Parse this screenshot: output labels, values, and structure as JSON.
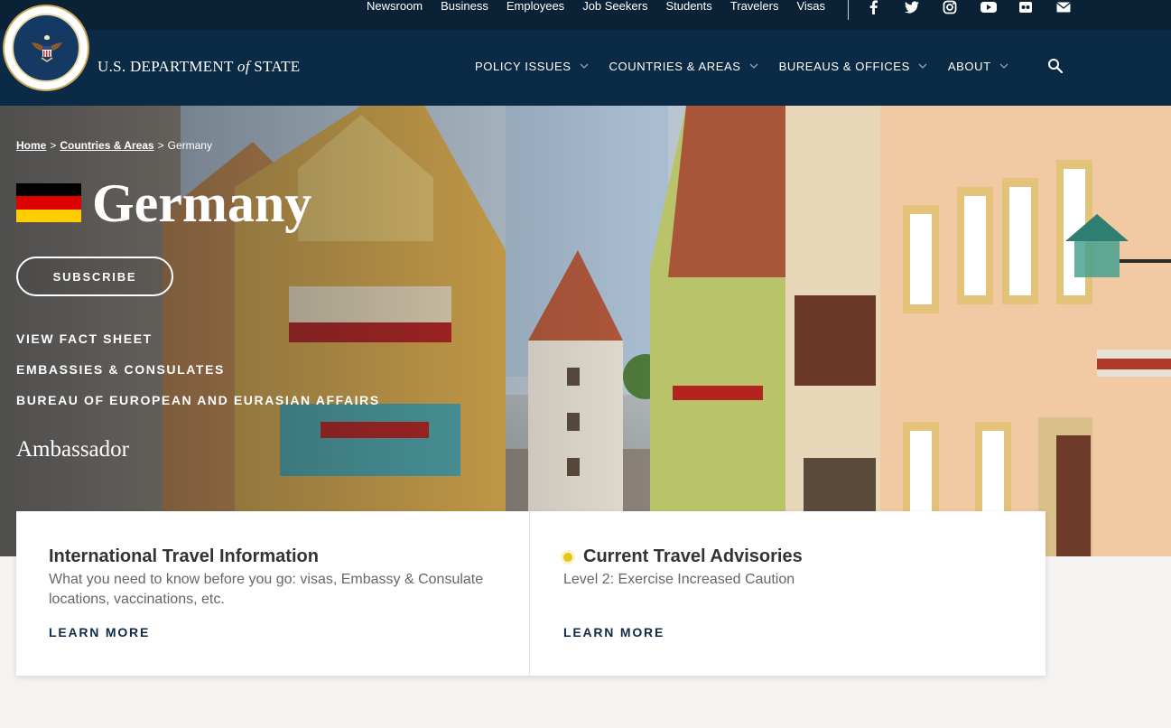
{
  "utility_nav": [
    "Newsroom",
    "Business",
    "Employees",
    "Job Seekers",
    "Students",
    "Travelers",
    "Visas"
  ],
  "social_icons": [
    "facebook-icon",
    "twitter-icon",
    "instagram-icon",
    "youtube-icon",
    "flickr-icon",
    "email-icon"
  ],
  "brand": {
    "prefix": "U.S. DEPARTMENT ",
    "of": "of",
    "suffix": " STATE"
  },
  "main_nav": [
    "POLICY ISSUES",
    "COUNTRIES & AREAS",
    "BUREAUS & OFFICES",
    "ABOUT"
  ],
  "breadcrumb": {
    "home": "Home",
    "sep": ">",
    "countries": "Countries & Areas",
    "current": "Germany"
  },
  "page": {
    "title": "Germany",
    "flag_colors": [
      "#000000",
      "#dd0000",
      "#ffce00"
    ],
    "subscribe": "SUBSCRIBE",
    "links": [
      "VIEW FACT SHEET",
      "EMBASSIES & CONSULATES",
      "BUREAU OF EUROPEAN AND EURASIAN AFFAIRS"
    ],
    "ambassador_heading": "Ambassador"
  },
  "cards": {
    "travel_info": {
      "title": "International Travel Information",
      "desc": "What you need to know before you go: visas, Embassy & Consulate locations, vaccinations, etc.",
      "cta": "LEARN MORE"
    },
    "advisories": {
      "title": "Current Travel Advisories",
      "level": "Level 2: Exercise Increased Caution",
      "cta": "LEARN MORE",
      "level_color": "#e3c41c"
    }
  },
  "colors": {
    "header": "#0a2a45",
    "utility": "#0b2236",
    "accent": "#0e2a47"
  }
}
